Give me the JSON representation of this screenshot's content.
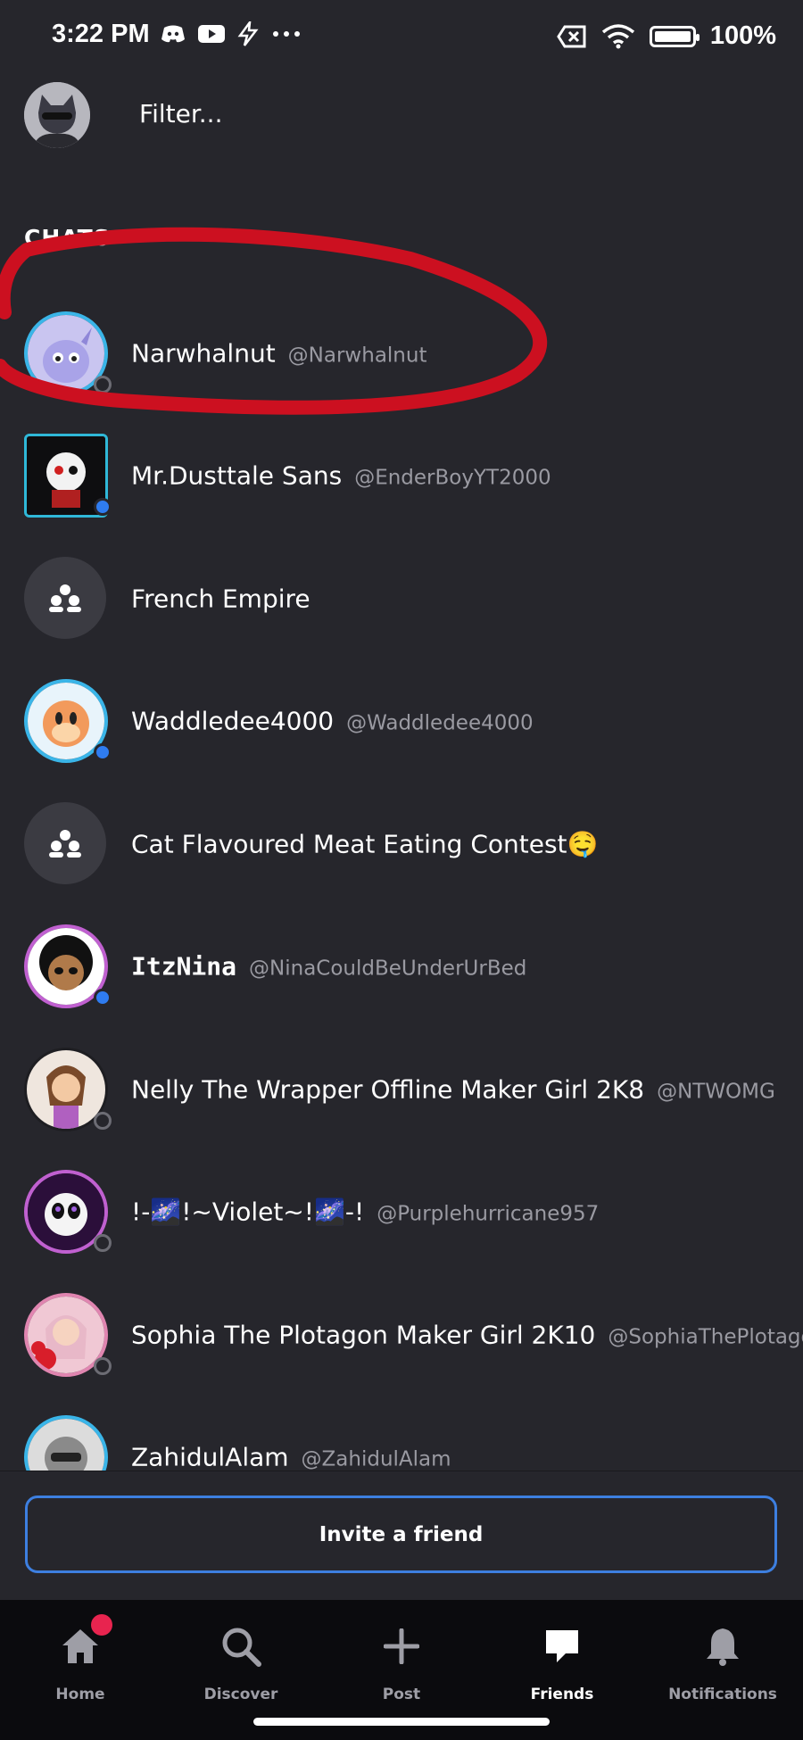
{
  "status_bar": {
    "time": "3:22 PM",
    "battery": "100%",
    "battery_level": 1.0,
    "left_icons": [
      "discord-icon",
      "youtube-icon",
      "bolt-icon",
      "more-dots-icon"
    ],
    "right_icons": [
      "data-off-icon",
      "wifi-icon",
      "battery-icon"
    ]
  },
  "filter": {
    "placeholder": "Filter..."
  },
  "section": {
    "title": "CHATS"
  },
  "chats": [
    {
      "name": "Narwhalnut",
      "handle": "@Narwhalnut",
      "status": "offline",
      "avatar_color": "#a9a3e8"
    },
    {
      "name": "Mr.Dusttale Sans",
      "handle": "@EnderBoyYT2000",
      "status": "online",
      "avatar_color": "#111111"
    },
    {
      "name": "French Empire",
      "handle": "",
      "status": "group",
      "avatar_color": "#3b3b42"
    },
    {
      "name": "Waddledee4000",
      "handle": "@Waddledee4000",
      "status": "online",
      "avatar_color": "#f29a5c"
    },
    {
      "name": "Cat Flavoured Meat Eating Contest🤤",
      "handle": "",
      "status": "group",
      "avatar_color": "#3b3b42"
    },
    {
      "name": "ItzNina",
      "handle": "@NinaCouldBeUnderUrBed",
      "status": "online",
      "avatar_color": "#7a4a2a"
    },
    {
      "name": "Nelly The Wrapper Offline Maker Girl 2K8",
      "handle": "@NTWOMG",
      "status": "offline",
      "avatar_color": "#e9dcd0"
    },
    {
      "name": "!-🌌!~Violet~!🌌-!",
      "handle": "@Purplehurricane957",
      "status": "offline",
      "avatar_color": "#2b0f3a"
    },
    {
      "name": "Sophia The Plotagon Maker Girl 2K10",
      "handle": "@SophiaThePlotagon",
      "status": "offline",
      "avatar_color": "#d98a9a"
    },
    {
      "name": "ZahidulAlam",
      "handle": "@ZahidulAlam",
      "status": "offline",
      "avatar_color": "#9a9a9a"
    }
  ],
  "invite": {
    "label": "Invite a friend"
  },
  "nav": [
    {
      "label": "Home",
      "icon": "home-icon"
    },
    {
      "label": "Discover",
      "icon": "search-icon"
    },
    {
      "label": "Post",
      "icon": "plus-icon"
    },
    {
      "label": "Friends",
      "icon": "chat-bubble-icon"
    },
    {
      "label": "Notifications",
      "icon": "bell-icon"
    }
  ],
  "colors": {
    "background": "#26262c",
    "online": "#2f7cf0",
    "invite_border": "#3d7fe0",
    "notification_dot": "#e8244f",
    "highlight": "#cc1020"
  }
}
